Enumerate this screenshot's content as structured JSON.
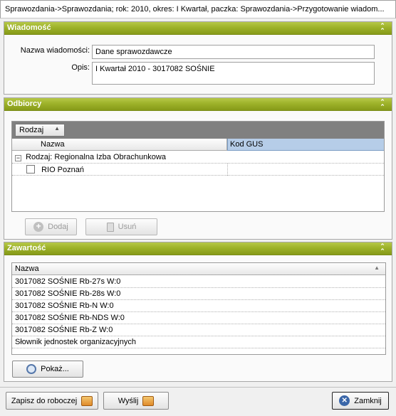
{
  "window": {
    "title": "Sprawozdania->Sprawozdania; rok: 2010, okres: I Kwartał, paczka: Sprawozdania->Przygotowanie wiadom..."
  },
  "wiadomosc": {
    "header": "Wiadomość",
    "name_label": "Nazwa wiadomości:",
    "name_value": "Dane sprawozdawcze",
    "desc_label": "Opis:",
    "desc_value": "I Kwartał 2010  -  3017082 SOŚNIE"
  },
  "odbiorcy": {
    "header": "Odbiorcy",
    "group_chip": "Rodzaj",
    "col_name": "Nazwa",
    "col_code": "Kod GUS",
    "group_row": "Rodzaj:  Regionalna Izba Obrachunkowa",
    "item_row": "RIO Poznań",
    "add_label": "Dodaj",
    "remove_label": "Usuń"
  },
  "zawartosc": {
    "header": "Zawartość",
    "col_name": "Nazwa",
    "rows": [
      "3017082  SOŚNIE   Rb-27s   W:0",
      "3017082  SOŚNIE   Rb-28s   W:0",
      "3017082  SOŚNIE   Rb-N   W:0",
      "3017082  SOŚNIE   Rb-NDS   W:0",
      "3017082  SOŚNIE   Rb-Z   W:0",
      "Słownik jednostek organizacyjnych"
    ],
    "show_label": "Pokaż..."
  },
  "footer": {
    "save_draft_label": "Zapisz do roboczej",
    "send_label": "Wyślij",
    "close_label": "Zamknij"
  },
  "colors": {
    "accent": "#9db22a",
    "selected_header": "#b6cde8"
  }
}
